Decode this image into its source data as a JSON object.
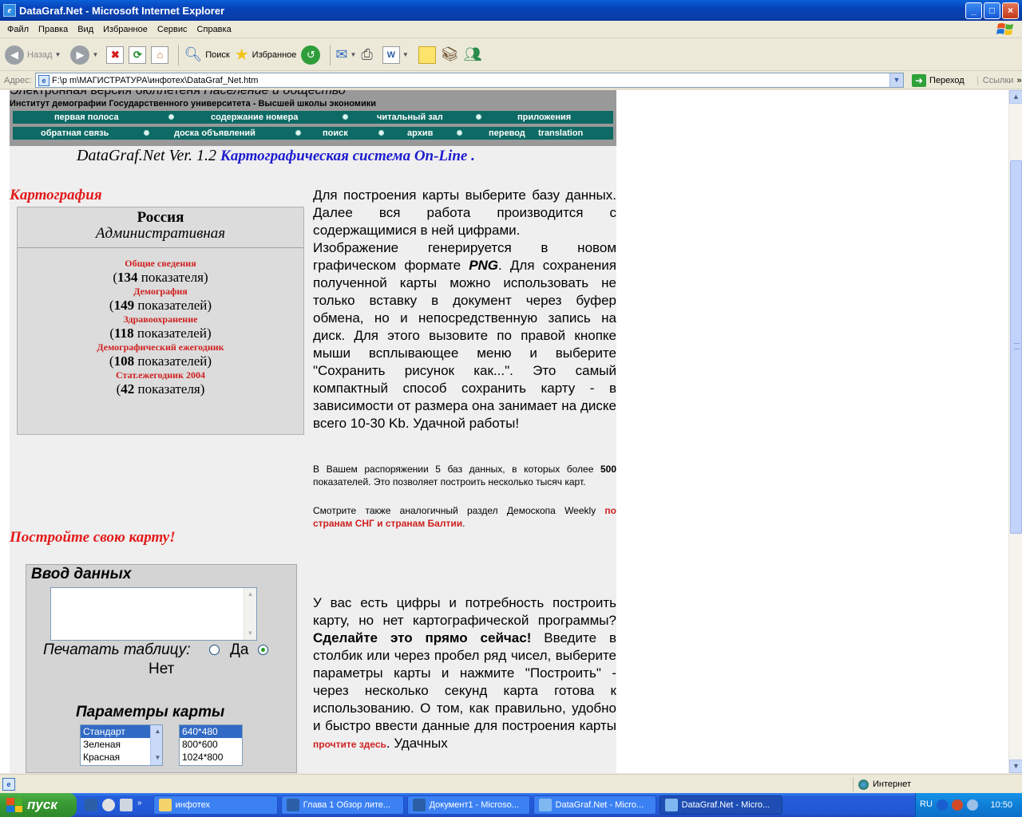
{
  "window": {
    "title": "DataGraf.Net - Microsoft Internet Explorer",
    "minimize": "_",
    "maximize": "□",
    "close": "×"
  },
  "menu": [
    "Файл",
    "Правка",
    "Вид",
    "Избранное",
    "Сервис",
    "Справка"
  ],
  "toolbar": {
    "back": "Назад",
    "search": "Поиск",
    "favorites": "Избранное"
  },
  "address": {
    "label": "Адрес:",
    "value": "F:\\р m\\МАГИСТРАТУРА\\инфотех\\DataGraf_Net.htm",
    "go": "Переход",
    "links": "Ссылки",
    "links_arrow": "»"
  },
  "header": {
    "title_plain": "Электронная версия бюллетеня ",
    "title_italic": "Население и общество",
    "subtitle": "Институт демографии Государственного университета - Высшей школы экономики",
    "nav_row1": [
      "первая полоса",
      "содержание номера",
      "читальный зал",
      "приложения"
    ],
    "nav_row2": [
      "обратная связь",
      "доска объявлений",
      "поиск",
      "архив",
      "перевод",
      "translation"
    ]
  },
  "page_title": {
    "name": "DataGraf.Net  Ver. 1.2 ",
    "subtitle": "Картографическая система On-Line ."
  },
  "cartography": {
    "heading": "Картография",
    "country": "Россия",
    "kind": "Административная",
    "databases": [
      {
        "name": "Общие сведения",
        "count": "134",
        "unit": "показателя"
      },
      {
        "name": "Демография",
        "count": "149",
        "unit": "показателей"
      },
      {
        "name": "Здравоохранение",
        "count": "118",
        "unit": "показателей"
      },
      {
        "name": "Демографический ежегодник",
        "count": "108",
        "unit": "показателей"
      },
      {
        "name": "Стат.ежегодник 2004",
        "count": "42",
        "unit": "показателя"
      }
    ]
  },
  "intro_text": {
    "p1": "Для построения карты выберите базу данных. Далее вся работа производится с содержащимися в ней цифрами.",
    "p2_a": "Изображение генерируется в новом графическом формате ",
    "p2_png": "PNG",
    "p2_b": ". Для сохранения полученной карты можно использовать не только вставку в документ через буфер обмена, но и непосредственную запись на диск. Для этого вызовите по правой кнопке мыши всплывающее меню и выберите \"Сохранить рисунок как...\". Это самый компактный способ сохранить карту - в зависимости от размера она занимает на диске всего 10-30 Kb.  Удачной работы!"
  },
  "small_text": {
    "s1_a": "В Вашем распоряжении 5 баз данных, в которых более ",
    "s1_b": "500",
    "s1_c": " показателей. Это позволяет построить несколько тысяч карт.",
    "s2_a": "Смотрите также аналогичный раздел Демоскопа Weekly ",
    "s2_link": "по странам СНГ и странам Балтии",
    "s2_c": "."
  },
  "build": {
    "heading": "Постройте свою карту!",
    "input_heading": "Ввод данных",
    "textarea_value": "",
    "print_label": "Печатать таблицу:",
    "yes": "Да",
    "no": "Нет",
    "params_heading": "Параметры карты",
    "color_options": [
      "Стандарт",
      "Зеленая",
      "Красная"
    ],
    "size_options": [
      "640*480",
      "800*600",
      "1024*800"
    ]
  },
  "bottom_text": {
    "a": "У вас есть цифры и потребность построить карту, но нет картографической программы? ",
    "bold": "Сделайте это прямо сейчас!",
    "b": " Введите в столбик или через пробел ряд чисел, выберите параметры карты и нажмите \"Построить\" - через несколько секунд карта готова к использованию. О том, как правильно, удобно и быстро ввести данные для построения карты ",
    "link": "прочтите здесь",
    "c": ". Удачных"
  },
  "status": {
    "zone": "Интернет"
  },
  "taskbar": {
    "start": "пуск",
    "more": "»",
    "tasks": [
      "инфотех",
      "Глава 1 Обзор лите...",
      "Документ1 - Microso...",
      "DataGraf.Net - Micro...",
      "DataGraf.Net - Micro..."
    ],
    "lang": "RU",
    "clock": "10:50"
  },
  "colors": {
    "nav_bg": "#0e6a64",
    "red_accent": "#e31a1a",
    "blue_accent": "#1b1bd0",
    "header_gray": "#999999"
  }
}
